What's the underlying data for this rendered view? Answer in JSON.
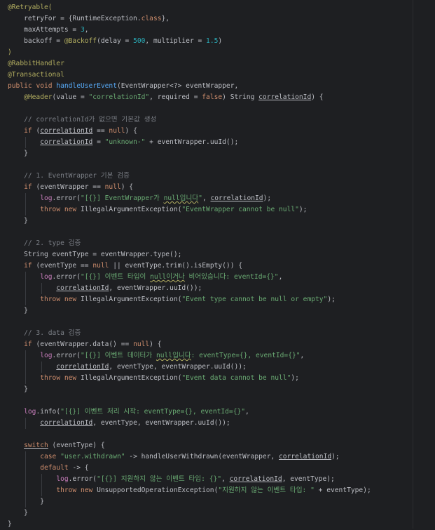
{
  "code_lines": [
    [
      {
        "t": "@Retryable(",
        "c": "ann"
      }
    ],
    [
      {
        "t": "    retryFor = {",
        "c": ""
      },
      {
        "t": "RuntimeException",
        "c": ""
      },
      {
        "t": ".",
        "c": ""
      },
      {
        "t": "class",
        "c": "kw"
      },
      {
        "t": "},",
        "c": ""
      }
    ],
    [
      {
        "t": "    maxAttempts = ",
        "c": ""
      },
      {
        "t": "3",
        "c": "num"
      },
      {
        "t": ",",
        "c": ""
      }
    ],
    [
      {
        "t": "    backoff = ",
        "c": ""
      },
      {
        "t": "@Backoff",
        "c": "ann"
      },
      {
        "t": "(delay = ",
        "c": ""
      },
      {
        "t": "500",
        "c": "num"
      },
      {
        "t": ", multiplier = ",
        "c": ""
      },
      {
        "t": "1.5",
        "c": "num"
      },
      {
        "t": ")",
        "c": ""
      }
    ],
    [
      {
        "t": ")",
        "c": "ann"
      }
    ],
    [
      {
        "t": "@RabbitHandler",
        "c": "ann"
      }
    ],
    [
      {
        "t": "@Transactional",
        "c": "ann"
      }
    ],
    [
      {
        "t": "public ",
        "c": "kw"
      },
      {
        "t": "void ",
        "c": "kw"
      },
      {
        "t": "handleUserEvent",
        "c": "fn"
      },
      {
        "t": "(EventWrapper<?> eventWrapper,",
        "c": ""
      }
    ],
    [
      {
        "t": "    ",
        "c": ""
      },
      {
        "t": "@Header",
        "c": "ann"
      },
      {
        "t": "(value = ",
        "c": ""
      },
      {
        "t": "\"correlationId\"",
        "c": "str"
      },
      {
        "t": ", required = ",
        "c": ""
      },
      {
        "t": "false",
        "c": "kw"
      },
      {
        "t": ") String ",
        "c": ""
      },
      {
        "t": "correlationId",
        "c": "ul"
      },
      {
        "t": ") {",
        "c": ""
      }
    ],
    [],
    [
      {
        "t": "    // correlationId가 없으면 기본값 생성",
        "c": "cmt"
      }
    ],
    [
      {
        "t": "    ",
        "c": ""
      },
      {
        "t": "if ",
        "c": "kw"
      },
      {
        "t": "(",
        "c": ""
      },
      {
        "t": "correlationId",
        "c": "ul"
      },
      {
        "t": " == ",
        "c": ""
      },
      {
        "t": "null",
        "c": "kw"
      },
      {
        "t": ") {",
        "c": ""
      }
    ],
    [
      {
        "t": "        ",
        "c": ""
      },
      {
        "t": "correlationId",
        "c": "ul"
      },
      {
        "t": " = ",
        "c": ""
      },
      {
        "t": "\"unknown-\"",
        "c": "str"
      },
      {
        "t": " + eventWrapper.uuId();",
        "c": ""
      }
    ],
    [
      {
        "t": "    }",
        "c": ""
      }
    ],
    [],
    [
      {
        "t": "    // 1. EventWrapper 기본 검증",
        "c": "cmt"
      }
    ],
    [
      {
        "t": "    ",
        "c": ""
      },
      {
        "t": "if ",
        "c": "kw"
      },
      {
        "t": "(eventWrapper == ",
        "c": ""
      },
      {
        "t": "null",
        "c": "kw"
      },
      {
        "t": ") {",
        "c": ""
      }
    ],
    [
      {
        "t": "        ",
        "c": ""
      },
      {
        "t": "log",
        "c": "field"
      },
      {
        "t": ".error(",
        "c": ""
      },
      {
        "t": "\"[{}] EventWrapper가 ",
        "c": "str"
      },
      {
        "t": "null입니다",
        "c": "str squig"
      },
      {
        "t": "\"",
        "c": "str"
      },
      {
        "t": ", ",
        "c": ""
      },
      {
        "t": "correlationId",
        "c": "ul"
      },
      {
        "t": ");",
        "c": ""
      }
    ],
    [
      {
        "t": "        ",
        "c": ""
      },
      {
        "t": "throw ",
        "c": "kw"
      },
      {
        "t": "new ",
        "c": "kw"
      },
      {
        "t": "IllegalArgumentException(",
        "c": ""
      },
      {
        "t": "\"EventWrapper cannot be null\"",
        "c": "str"
      },
      {
        "t": ");",
        "c": ""
      }
    ],
    [
      {
        "t": "    }",
        "c": ""
      }
    ],
    [],
    [
      {
        "t": "    // 2. type 검증",
        "c": "cmt"
      }
    ],
    [
      {
        "t": "    String eventType = eventWrapper.type();",
        "c": ""
      }
    ],
    [
      {
        "t": "    ",
        "c": ""
      },
      {
        "t": "if ",
        "c": "kw"
      },
      {
        "t": "(eventType == ",
        "c": ""
      },
      {
        "t": "null ",
        "c": "kw"
      },
      {
        "t": "|| eventType.trim().isEmpty()) {",
        "c": ""
      }
    ],
    [
      {
        "t": "        ",
        "c": ""
      },
      {
        "t": "log",
        "c": "field"
      },
      {
        "t": ".error(",
        "c": ""
      },
      {
        "t": "\"[{}] 이벤트 타입이 ",
        "c": "str"
      },
      {
        "t": "null이거나",
        "c": "str squig"
      },
      {
        "t": " 비어있습니다: eventId={}\"",
        "c": "str"
      },
      {
        "t": ",",
        "c": ""
      }
    ],
    [
      {
        "t": "            ",
        "c": ""
      },
      {
        "t": "correlationId",
        "c": "ul"
      },
      {
        "t": ", eventWrapper.uuId());",
        "c": ""
      }
    ],
    [
      {
        "t": "        ",
        "c": ""
      },
      {
        "t": "throw ",
        "c": "kw"
      },
      {
        "t": "new ",
        "c": "kw"
      },
      {
        "t": "IllegalArgumentException(",
        "c": ""
      },
      {
        "t": "\"Event type cannot be null or empty\"",
        "c": "str"
      },
      {
        "t": ");",
        "c": ""
      }
    ],
    [
      {
        "t": "    }",
        "c": ""
      }
    ],
    [],
    [
      {
        "t": "    // 3. data 검증",
        "c": "cmt"
      }
    ],
    [
      {
        "t": "    ",
        "c": ""
      },
      {
        "t": "if ",
        "c": "kw"
      },
      {
        "t": "(eventWrapper.data() == ",
        "c": ""
      },
      {
        "t": "null",
        "c": "kw"
      },
      {
        "t": ") {",
        "c": ""
      }
    ],
    [
      {
        "t": "        ",
        "c": ""
      },
      {
        "t": "log",
        "c": "field"
      },
      {
        "t": ".error(",
        "c": ""
      },
      {
        "t": "\"[{}] 이벤트 데이터가 ",
        "c": "str"
      },
      {
        "t": "null입니다",
        "c": "str squig"
      },
      {
        "t": ": eventType={}, eventId={}\"",
        "c": "str"
      },
      {
        "t": ",",
        "c": ""
      }
    ],
    [
      {
        "t": "            ",
        "c": ""
      },
      {
        "t": "correlationId",
        "c": "ul"
      },
      {
        "t": ", eventType, eventWrapper.uuId());",
        "c": ""
      }
    ],
    [
      {
        "t": "        ",
        "c": ""
      },
      {
        "t": "throw ",
        "c": "kw"
      },
      {
        "t": "new ",
        "c": "kw"
      },
      {
        "t": "IllegalArgumentException(",
        "c": ""
      },
      {
        "t": "\"Event data cannot be null\"",
        "c": "str"
      },
      {
        "t": ");",
        "c": ""
      }
    ],
    [
      {
        "t": "    }",
        "c": ""
      }
    ],
    [],
    [
      {
        "t": "    ",
        "c": ""
      },
      {
        "t": "log",
        "c": "field"
      },
      {
        "t": ".info(",
        "c": ""
      },
      {
        "t": "\"[{}] 이벤트 처리 시작: eventType={}, eventId={}\"",
        "c": "str"
      },
      {
        "t": ",",
        "c": ""
      }
    ],
    [
      {
        "t": "        ",
        "c": ""
      },
      {
        "t": "correlationId",
        "c": "ul"
      },
      {
        "t": ", eventType, eventWrapper.uuId());",
        "c": ""
      }
    ],
    [],
    [
      {
        "t": "    ",
        "c": ""
      },
      {
        "t": "switch",
        "c": "kw ul"
      },
      {
        "t": " (eventType) {",
        "c": ""
      }
    ],
    [
      {
        "t": "        ",
        "c": ""
      },
      {
        "t": "case ",
        "c": "kw"
      },
      {
        "t": "\"user.withdrawn\"",
        "c": "str"
      },
      {
        "t": " -> handleUserWithdrawn(eventWrapper, ",
        "c": ""
      },
      {
        "t": "correlationId",
        "c": "ul"
      },
      {
        "t": ");",
        "c": ""
      }
    ],
    [
      {
        "t": "        ",
        "c": ""
      },
      {
        "t": "default ",
        "c": "kw"
      },
      {
        "t": "-> {",
        "c": ""
      }
    ],
    [
      {
        "t": "            ",
        "c": ""
      },
      {
        "t": "log",
        "c": "field"
      },
      {
        "t": ".error(",
        "c": ""
      },
      {
        "t": "\"[{}] 지원하지 않는 이벤트 타입: {}\"",
        "c": "str"
      },
      {
        "t": ", ",
        "c": ""
      },
      {
        "t": "correlationId",
        "c": "ul"
      },
      {
        "t": ", eventType);",
        "c": ""
      }
    ],
    [
      {
        "t": "            ",
        "c": ""
      },
      {
        "t": "throw ",
        "c": "kw"
      },
      {
        "t": "new ",
        "c": "kw"
      },
      {
        "t": "UnsupportedOperationException(",
        "c": ""
      },
      {
        "t": "\"지원하지 않는 이벤트 타입: \"",
        "c": "str"
      },
      {
        "t": " + eventType);",
        "c": ""
      }
    ],
    [
      {
        "t": "        }",
        "c": ""
      }
    ],
    [
      {
        "t": "    }",
        "c": ""
      }
    ],
    [
      {
        "t": "}",
        "c": ""
      }
    ]
  ]
}
